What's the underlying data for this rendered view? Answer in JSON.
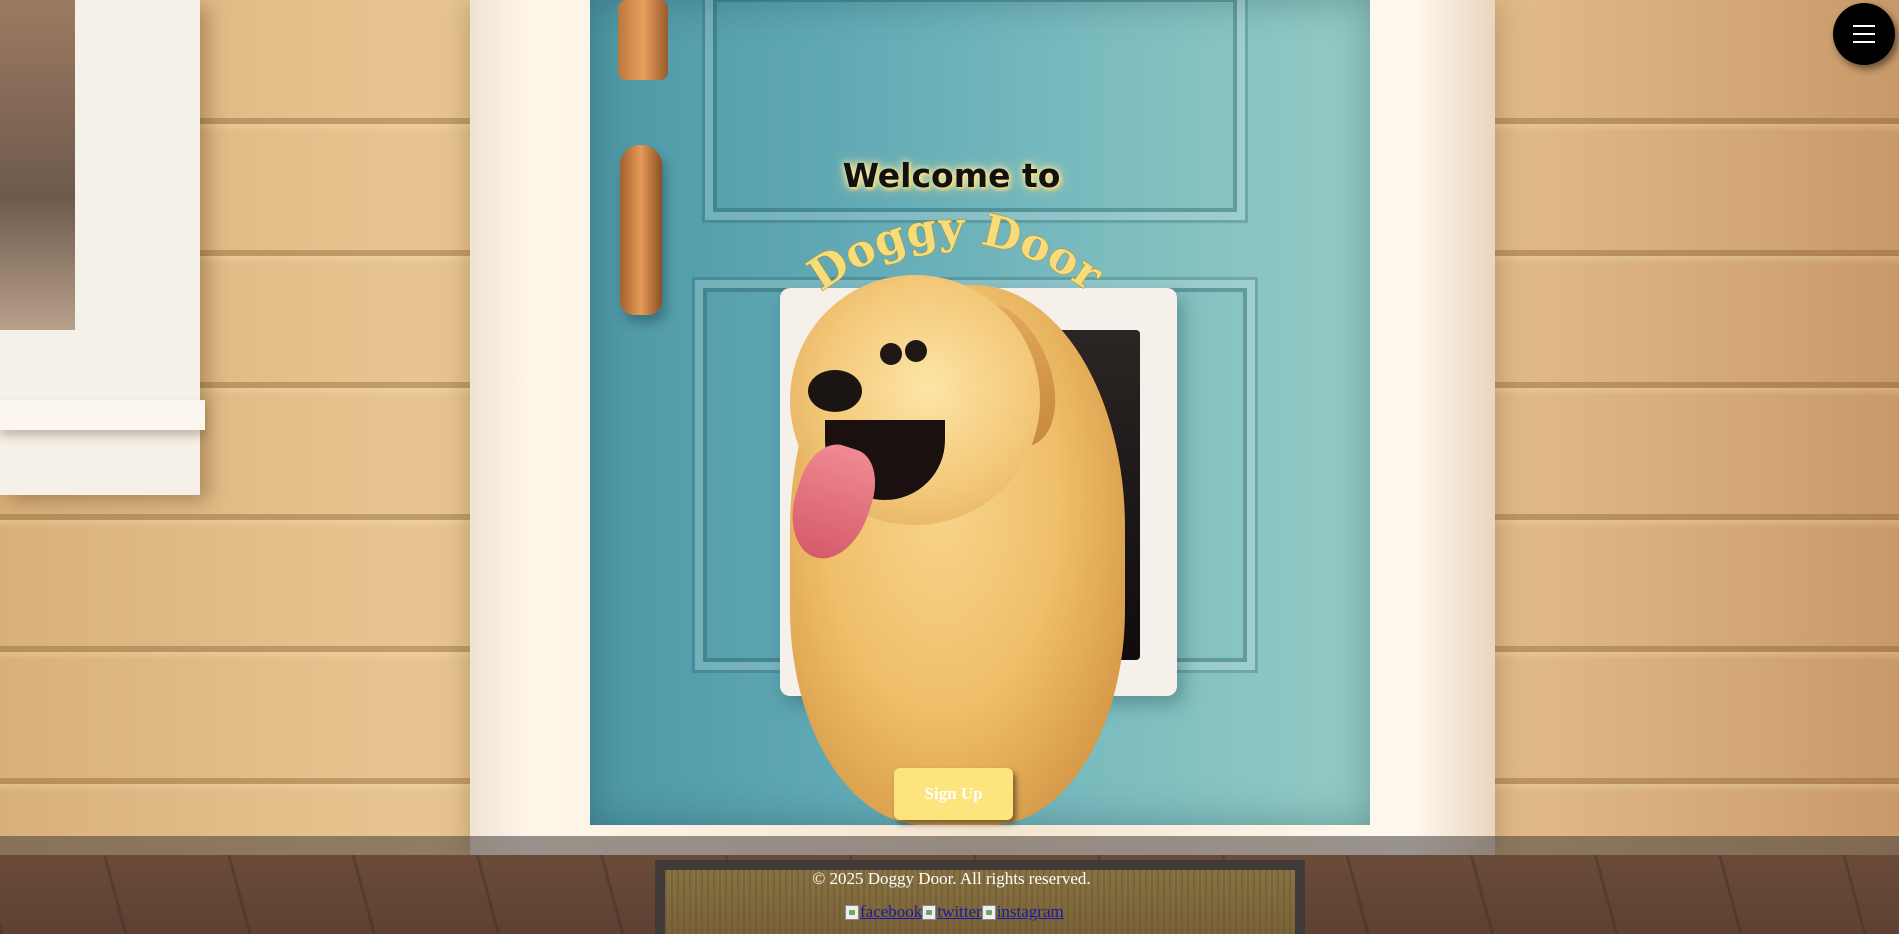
{
  "menu": {
    "icon": "hamburger-menu-icon"
  },
  "hero": {
    "welcome": "Welcome to",
    "brand": "Doggy Door"
  },
  "signup": {
    "label": "Sign Up"
  },
  "footer": {
    "copyright": "© 2025 Doggy Door. All rights reserved.",
    "social": [
      {
        "label": "facebook",
        "icon": "facebook-icon"
      },
      {
        "label": "twitter",
        "icon": "twitter-icon"
      },
      {
        "label": "instagram",
        "icon": "instagram-icon"
      }
    ]
  },
  "colors": {
    "accent": "#fde47c",
    "brand_text": "#f6dd7a",
    "menu_bg": "#000000",
    "footer_bg": "rgba(70,64,62,0.55)",
    "link": "#1a1aa8"
  }
}
